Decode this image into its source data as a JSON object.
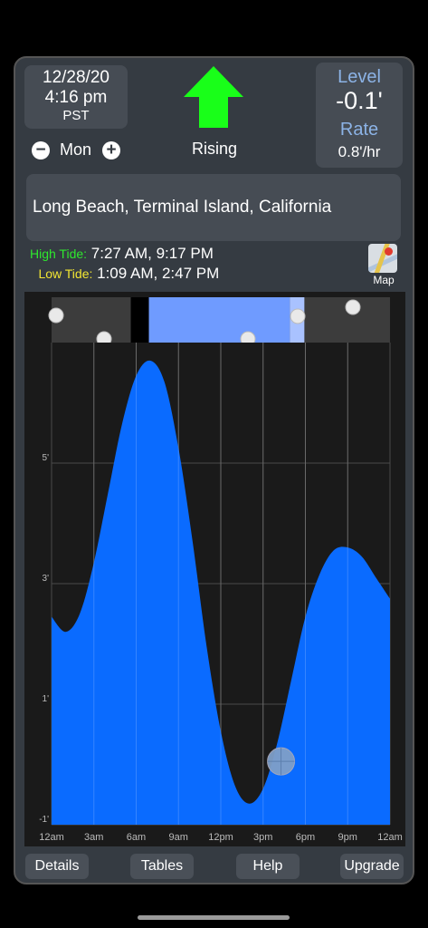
{
  "date": {
    "date": "12/28/20",
    "time": "4:16 pm",
    "tz": "PST"
  },
  "day_nav": {
    "minus_icon": "minus-circle-icon",
    "day": "Mon",
    "plus_icon": "plus-circle-icon"
  },
  "trend": {
    "label": "Rising",
    "arrow_icon": "up-arrow-icon",
    "arrow_color": "#19ff19"
  },
  "level": {
    "level_label": "Level",
    "level_value": "-0.1'",
    "rate_label": "Rate",
    "rate_value": "0.8'/hr"
  },
  "location": "Long Beach, Terminal Island, California",
  "tides": {
    "high_label": "High Tide:",
    "high_times": "7:27 AM, 9:17 PM",
    "low_label": "Low Tide:",
    "low_times": "1:09 AM, 2:47 PM"
  },
  "map_button": {
    "label": "Map",
    "icon": "map-icon"
  },
  "chart_data": {
    "type": "area",
    "x_tick_labels": [
      "12am",
      "3am",
      "6am",
      "9am",
      "12pm",
      "3pm",
      "6pm",
      "9pm",
      "12am"
    ],
    "y_tick_labels": [
      "-1'",
      "1'",
      "3'",
      "5'"
    ],
    "ylim": [
      -1,
      7
    ],
    "xlim": [
      0,
      24
    ],
    "x_hours": [
      0,
      1,
      2,
      3,
      4,
      5,
      6,
      7,
      8,
      9,
      10,
      11,
      12,
      13,
      14,
      15,
      16,
      17,
      18,
      19,
      20,
      21,
      22,
      23,
      24
    ],
    "tide_ft": [
      2.45,
      2.2,
      2.5,
      3.35,
      4.5,
      5.65,
      6.45,
      6.7,
      6.35,
      5.25,
      3.7,
      1.95,
      0.55,
      -0.35,
      -0.65,
      -0.4,
      0.35,
      1.4,
      2.45,
      3.15,
      3.55,
      3.6,
      3.45,
      3.1,
      2.75
    ],
    "fill_color": "#0a6bff",
    "background_color": "#1a1a1a",
    "grid": true,
    "current_time_hours": 16.27,
    "current_level_ft": -0.1,
    "daylight_band": {
      "sunrise_hours": 6.9,
      "sunset_hours": 16.9,
      "color": "#6f9bff"
    }
  },
  "bottom_bar": {
    "details": "Details",
    "tables": "Tables",
    "help": "Help",
    "upgrade": "Upgrade"
  }
}
